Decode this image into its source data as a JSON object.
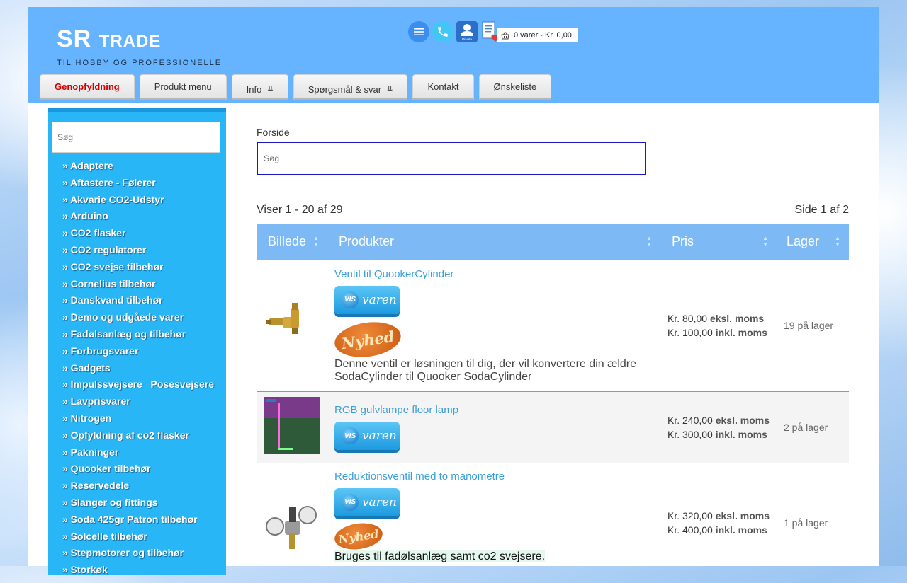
{
  "header": {
    "logo_main": "SR",
    "logo_sub": "TRADE",
    "tagline": "TIL HOBBY OG PROFESSIONELLE",
    "user_icon_label": "Private",
    "cart": "0 varer - Kr. 0,00"
  },
  "nav": {
    "items": [
      "Genopfyldning",
      "Produkt menu",
      "Info",
      "Spørgsmål & svar",
      "Kontakt",
      "Ønskeliste"
    ]
  },
  "sidebar": {
    "search_placeholder": "Søg",
    "categories": [
      "» Adaptere",
      "» Aftastere - Følerer",
      "» Akvarie CO2-Udstyr",
      "» Arduino",
      "» CO2 flasker",
      "» CO2 regulatorer",
      "» CO2 svejse tilbehør",
      "» Cornelius tilbehør",
      "» Danskvand tilbehør",
      "» Demo og udgåede varer",
      "» Fadølsanlæg og tilbehør",
      "» Forbrugsvarer",
      "» Gadgets",
      "» Impulssvejsere   Posesvejsere",
      "» Lavprisvarer",
      "» Nitrogen",
      "» Opfyldning af co2 flasker",
      "» Pakninger",
      "» Quooker tilbehør",
      "» Reservedele",
      "» Slanger og fittings",
      "» Soda 425gr Patron tilbehør",
      "» Solcelle tilbehør",
      "» Stepmotorer og tilbehør",
      "» Storkøk"
    ]
  },
  "main": {
    "breadcrumb": "Forside",
    "search_placeholder": "Søg",
    "count": "Viser 1 - 20 af 29",
    "page": "Side 1 af 2",
    "columns": [
      "Billede",
      "Produkter",
      "Pris",
      "Lager"
    ],
    "vis_badge": "VIS",
    "vis_text": "varen",
    "nyhed": "Nyhed",
    "excl": "eksl. moms",
    "incl": "inkl. moms",
    "products": [
      {
        "name": "Ventil til QuookerCylinder",
        "desc": "Denne ventil er løsningen til dig, der vil konvertere din ældre SodaCylinder til Quooker SodaCylinder",
        "price_excl": "Kr. 80,00",
        "price_incl": "Kr. 100,00",
        "stock": "19 på lager"
      },
      {
        "name": "RGB gulvlampe floor lamp",
        "price_excl": "Kr. 240,00",
        "price_incl": "Kr. 300,00",
        "stock": "2 på lager"
      },
      {
        "name": "Reduktionsventil med to manometre",
        "desc": "Bruges til fadølsanlæg samt co2 svejsere.",
        "price_excl": "Kr. 320,00",
        "price_incl": "Kr. 400,00",
        "stock": "1 på lager"
      }
    ]
  },
  "colors": {
    "header_bg": "#66b3ff",
    "sidebar_bg": "#29b6f6",
    "table_header_bg": "#7cb9f5",
    "link": "#3b9fd8",
    "active_nav": "#d40000",
    "search_border": "#1818c8"
  }
}
